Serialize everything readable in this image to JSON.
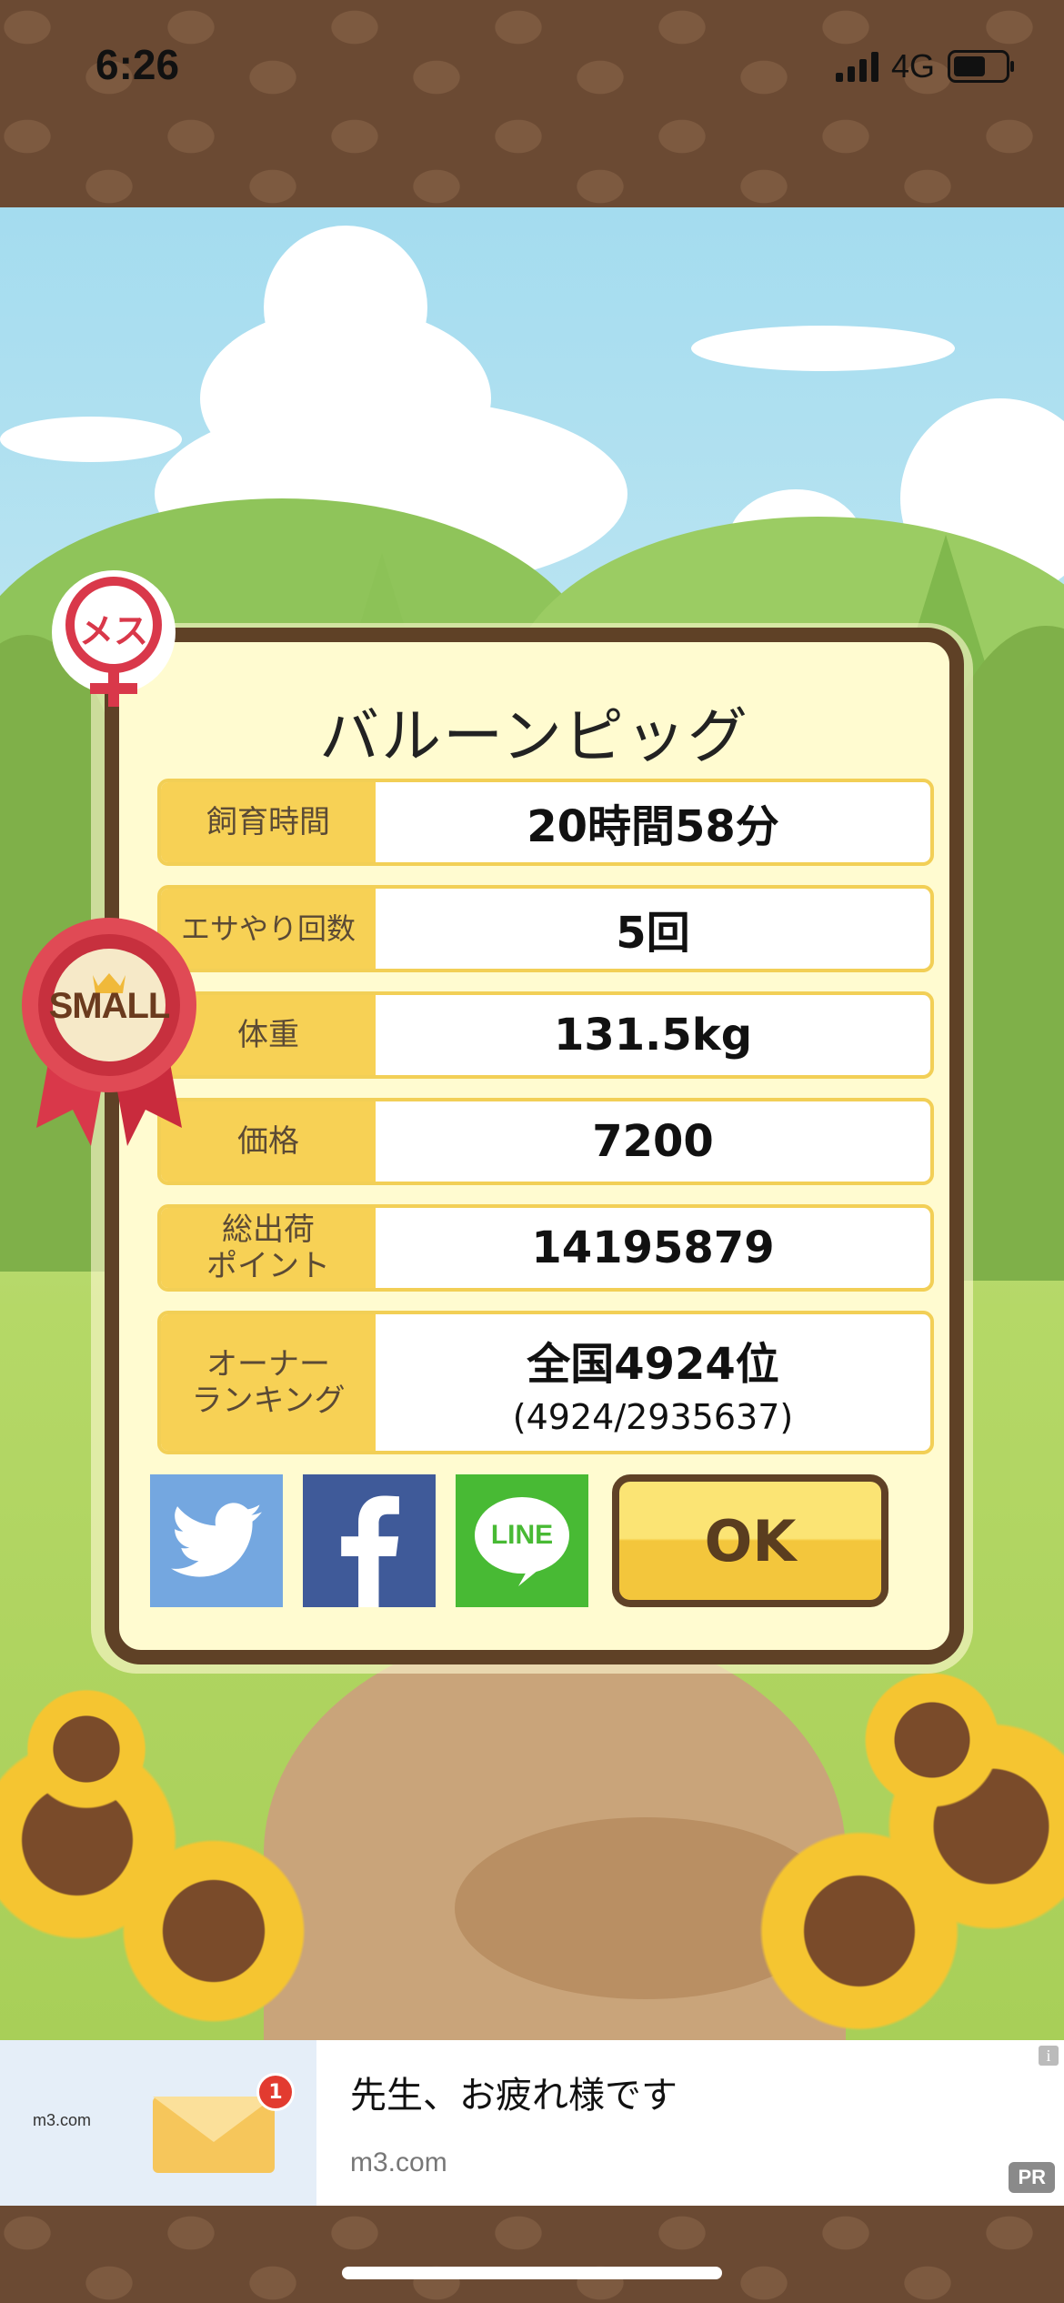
{
  "status_bar": {
    "time": "6:26",
    "network": "4G"
  },
  "dialog": {
    "title": "バルーンピッグ",
    "stats": [
      {
        "label": "飼育時間",
        "value": "20時間58分"
      },
      {
        "label": "エサやり回数",
        "value": "5回"
      },
      {
        "label": "体重",
        "value": "131.5kg"
      },
      {
        "label": "価格",
        "value": "7200"
      },
      {
        "label": "総出荷\nポイント",
        "value": "14195879"
      },
      {
        "label": "オーナー\nランキング",
        "value": "全国4924位",
        "sub": "(4924/2935637)"
      }
    ],
    "ok_label": "OK",
    "share": {
      "line_label": "LINE"
    }
  },
  "badges": {
    "gender": "メス",
    "size": "SMALL"
  },
  "ad": {
    "logo": "m3.com",
    "notification_count": "1",
    "title": "先生、お疲れ様です",
    "domain": "m3.com",
    "pr_label": "PR",
    "info_label": "i"
  },
  "icons": {
    "share_twitter": "twitter-bird-icon",
    "share_facebook": "facebook-f-icon",
    "share_line": "line-speech-bubble-icon"
  },
  "colors": {
    "twitter": "#74a7e0",
    "facebook": "#3f5a99",
    "line": "#48ba34",
    "dialog_border": "#5f4126",
    "label_bg": "#f7d155"
  }
}
